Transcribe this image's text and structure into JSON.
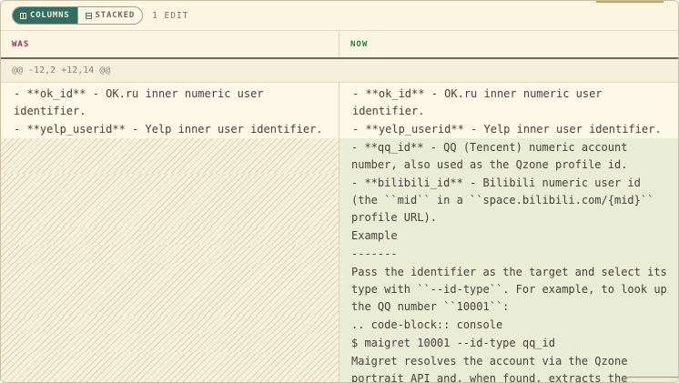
{
  "toolbar": {
    "view_columns": "COLUMNS",
    "view_stacked": "STACKED",
    "edit_count": "1 EDIT"
  },
  "columns": {
    "was": "WAS",
    "now": "NOW"
  },
  "hunk_header": "@@ -12,2 +12,14 @@",
  "context_lines": [
    "- **ok_id** - OK.ru inner numeric user identifier.",
    "- **yelp_userid** - Yelp inner user identifier."
  ],
  "added_lines": [
    "- **qq_id** - QQ (Tencent) numeric account number, also used as the Qzone profile id.",
    "- **bilibili_id** - Bilibili numeric user id (the ``mid`` in a ``space.bilibili.com/{mid}`` profile URL).",
    "Example",
    "-------",
    "Pass the identifier as the target and select its type with ``--id-type``. For example, to look up the QQ number ``10001``:",
    ".. code-block:: console",
    "$ maigret 10001 --id-type qq_id",
    "Maigret resolves the account via the Qzone portrait API and, when found, extracts the"
  ],
  "colors": {
    "accent": "#2f6f63",
    "removed_label": "#9c2d60",
    "added_label": "#2f7a3c",
    "added_bg": "#eaedd5"
  }
}
